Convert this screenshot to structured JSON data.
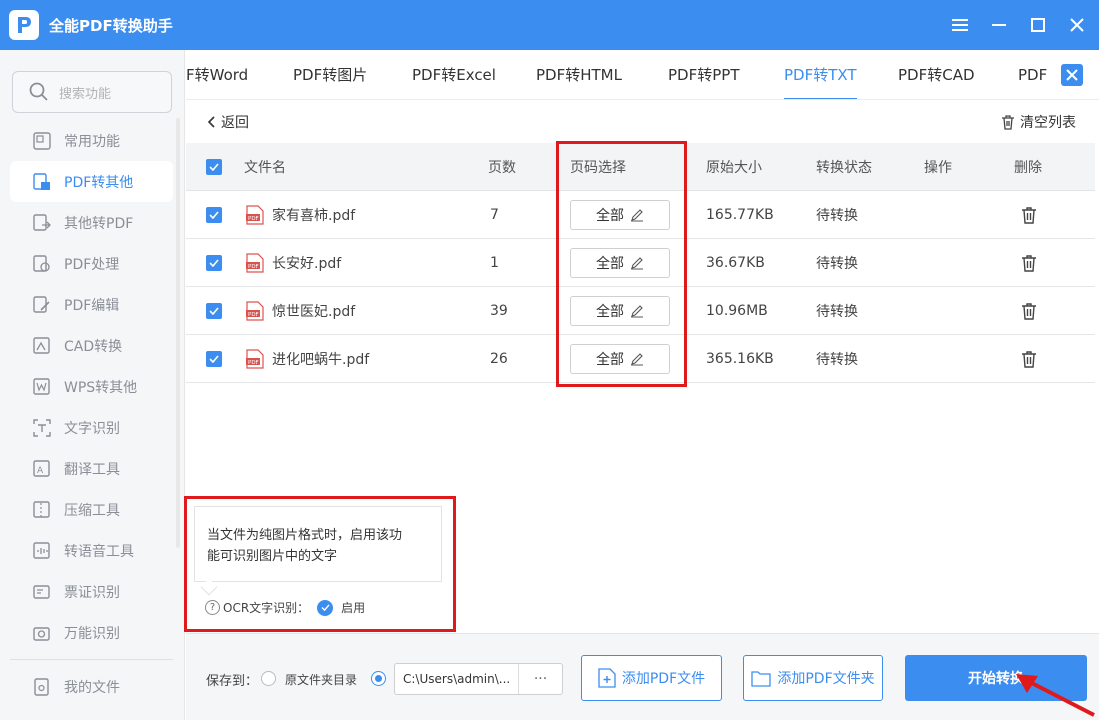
{
  "app": {
    "title": "全能PDF转换助手"
  },
  "colors": {
    "accent": "#3c8df0",
    "highlight": "#e0191c"
  },
  "window_controls": [
    "menu-icon",
    "minimize-icon",
    "maximize-icon",
    "close-icon"
  ],
  "sidebar": {
    "search_placeholder": "搜索功能",
    "items": [
      {
        "label": "常用功能",
        "icon": "common-icon",
        "active": false
      },
      {
        "label": "PDF转其他",
        "icon": "pdf-convert-icon",
        "active": true
      },
      {
        "label": "其他转PDF",
        "icon": "to-pdf-icon",
        "active": false
      },
      {
        "label": "PDF处理",
        "icon": "pdf-process-icon",
        "active": false
      },
      {
        "label": "PDF编辑",
        "icon": "pdf-edit-icon",
        "active": false
      },
      {
        "label": "CAD转换",
        "icon": "cad-icon",
        "active": false
      },
      {
        "label": "WPS转其他",
        "icon": "wps-icon",
        "active": false
      },
      {
        "label": "文字识别",
        "icon": "ocr-icon",
        "active": false
      },
      {
        "label": "翻译工具",
        "icon": "translate-icon",
        "active": false
      },
      {
        "label": "压缩工具",
        "icon": "compress-icon",
        "active": false
      },
      {
        "label": "转语音工具",
        "icon": "voice-icon",
        "active": false
      },
      {
        "label": "票证识别",
        "icon": "ticket-icon",
        "active": false
      },
      {
        "label": "万能识别",
        "icon": "camera-icon",
        "active": false
      }
    ],
    "my_files": "我的文件"
  },
  "tabs": [
    {
      "label": "F转Word",
      "active": false
    },
    {
      "label": "PDF转图片",
      "active": false
    },
    {
      "label": "PDF转Excel",
      "active": false
    },
    {
      "label": "PDF转HTML",
      "active": false
    },
    {
      "label": "PDF转PPT",
      "active": false
    },
    {
      "label": "PDF转TXT",
      "active": true
    },
    {
      "label": "PDF转CAD",
      "active": false
    },
    {
      "label": "PDF",
      "active": false
    }
  ],
  "toolbar": {
    "back": "返回",
    "clear_list": "清空列表"
  },
  "table": {
    "headers": {
      "filename": "文件名",
      "pages": "页数",
      "page_range": "页码选择",
      "size": "原始大小",
      "status": "转换状态",
      "action": "操作",
      "delete": "删除"
    },
    "rows": [
      {
        "filename": "家有喜柿.pdf",
        "pages": "7",
        "page_range": "全部",
        "size": "165.77KB",
        "status": "待转换",
        "checked": true
      },
      {
        "filename": "长安好.pdf",
        "pages": "1",
        "page_range": "全部",
        "size": "36.67KB",
        "status": "待转换",
        "checked": true
      },
      {
        "filename": "惊世医妃.pdf",
        "pages": "39",
        "page_range": "全部",
        "size": "10.96MB",
        "status": "待转换",
        "checked": true
      },
      {
        "filename": "进化吧蜗牛.pdf",
        "pages": "26",
        "page_range": "全部",
        "size": "365.16KB",
        "status": "待转换",
        "checked": true
      }
    ]
  },
  "ocr": {
    "tooltip_line1": "当文件为纯图片格式时，启用该功",
    "tooltip_line2": "能可识别图片中的文字",
    "label": "OCR文字识别：",
    "enabled_label": "启用",
    "enabled": true
  },
  "bottom": {
    "save_to": "保存到：",
    "option_source": "原文件夹目录",
    "path_value": "C:\\Users\\admin\\...",
    "path_more": "···",
    "add_file": "添加PDF文件",
    "add_folder": "添加PDF文件夹",
    "start": "开始转换"
  }
}
